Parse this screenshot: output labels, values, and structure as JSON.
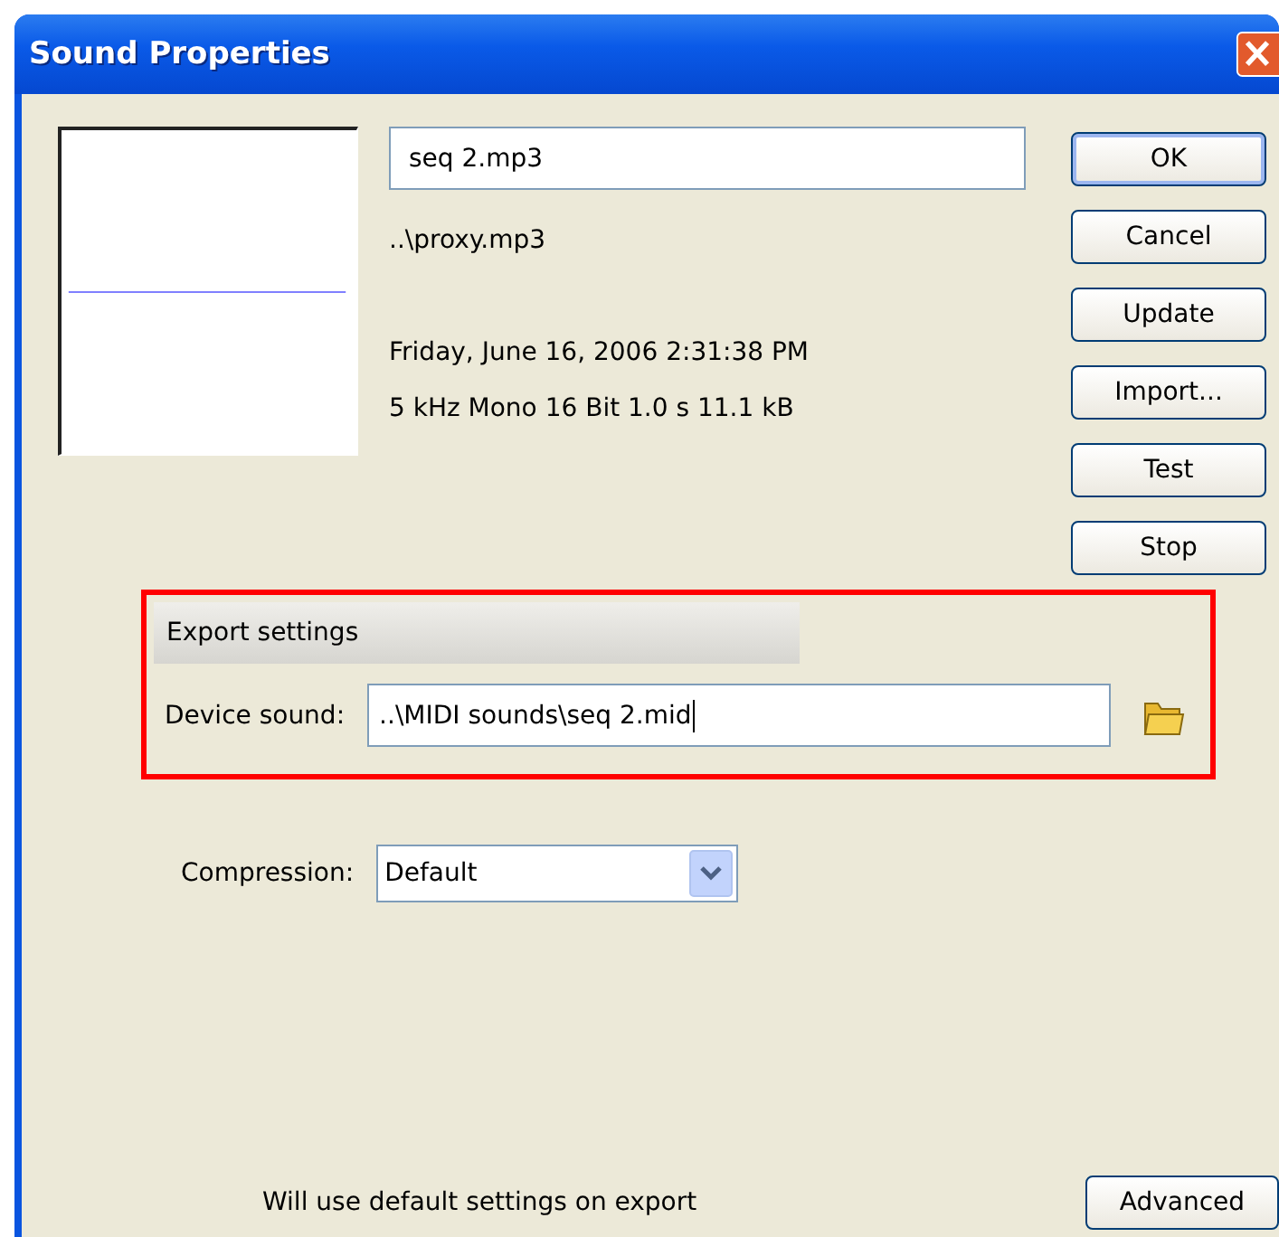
{
  "window": {
    "title": "Sound Properties"
  },
  "sound": {
    "name": "seq 2.mp3",
    "path": "..\\proxy.mp3",
    "date": "Friday, June 16, 2006  2:31:38 PM",
    "info": "5 kHz Mono 16 Bit 1.0 s 11.1 kB"
  },
  "buttons": [
    {
      "label": "OK",
      "default": true
    },
    {
      "label": "Cancel",
      "default": false
    },
    {
      "label": "Update",
      "default": false
    },
    {
      "label": "Import...",
      "default": false
    },
    {
      "label": "Test",
      "default": false
    },
    {
      "label": "Stop",
      "default": false
    }
  ],
  "export_settings": {
    "title": "Export settings",
    "device_sound_label": "Device sound:",
    "device_sound_value": "..\\MIDI sounds\\seq 2.mid"
  },
  "compression": {
    "label": "Compression:",
    "value": "Default"
  },
  "status_text": "Will use default settings on export",
  "advanced_button": "Advanced"
}
